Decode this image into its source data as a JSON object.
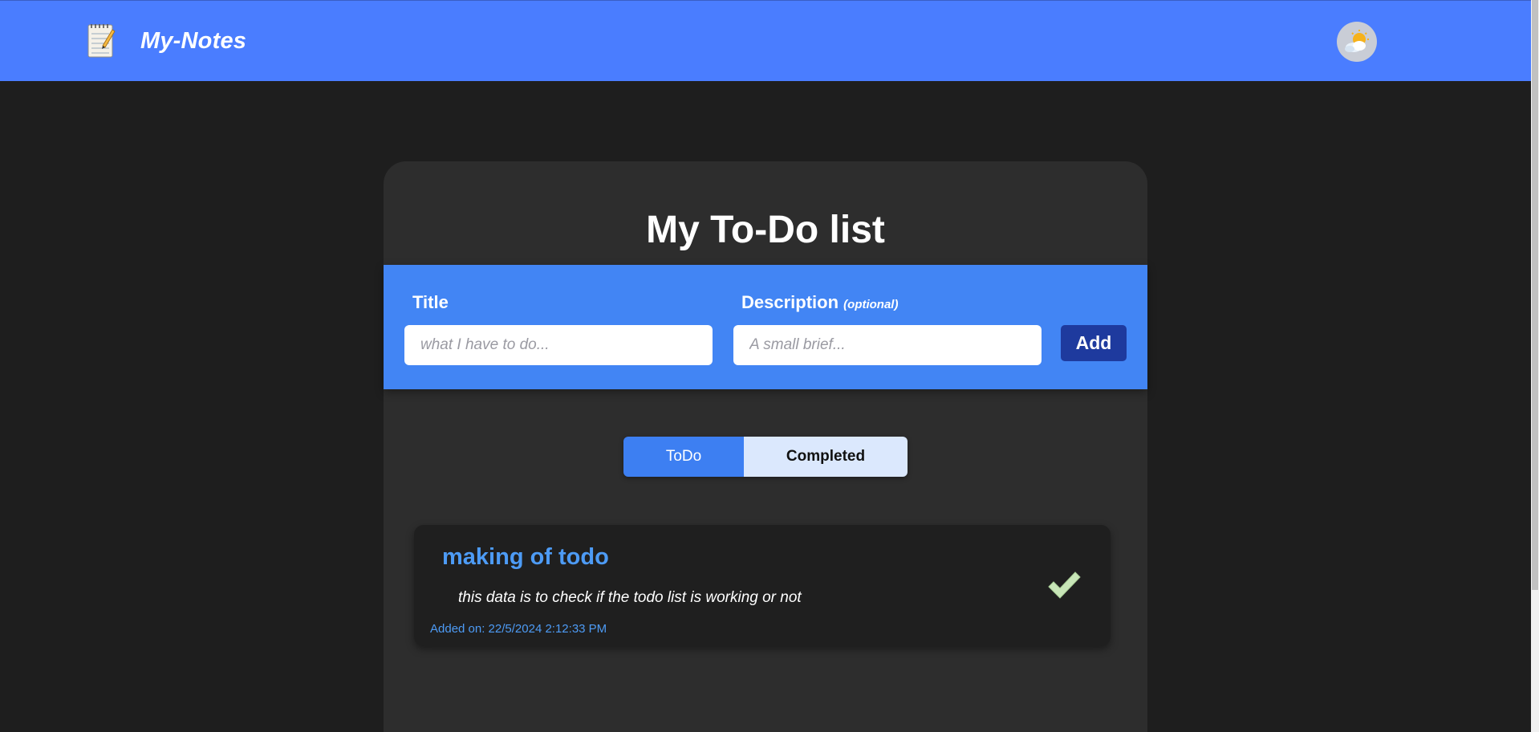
{
  "app": {
    "brand_title": "My-Notes",
    "brand_icon": "notepad-icon",
    "theme_icon": "weather-partly-cloudy-icon"
  },
  "main": {
    "title": "My To-Do list",
    "form": {
      "title_label": "Title",
      "title_placeholder": "what I have to do...",
      "title_value": "",
      "description_label": "Description",
      "description_optional": "(optional)",
      "description_placeholder": "A small brief...",
      "description_value": "",
      "add_label": "Add"
    },
    "tabs": [
      {
        "label": "ToDo",
        "active": true
      },
      {
        "label": "Completed",
        "active": false
      }
    ],
    "todos": [
      {
        "title": "making of todo",
        "description": "this data is to check if the todo list is working or not",
        "added_on": "Added on: 22/5/2024 2:12:33 PM",
        "action_icon": "checkmark-icon"
      }
    ]
  },
  "colors": {
    "navbar": "#4a7dff",
    "background": "#1e1e1e",
    "card": "#2d2d2d",
    "form_band": "#4285f4",
    "add_button": "#1e3a9e",
    "todo_title": "#4d9bf5",
    "check": "#c8e6b8"
  }
}
